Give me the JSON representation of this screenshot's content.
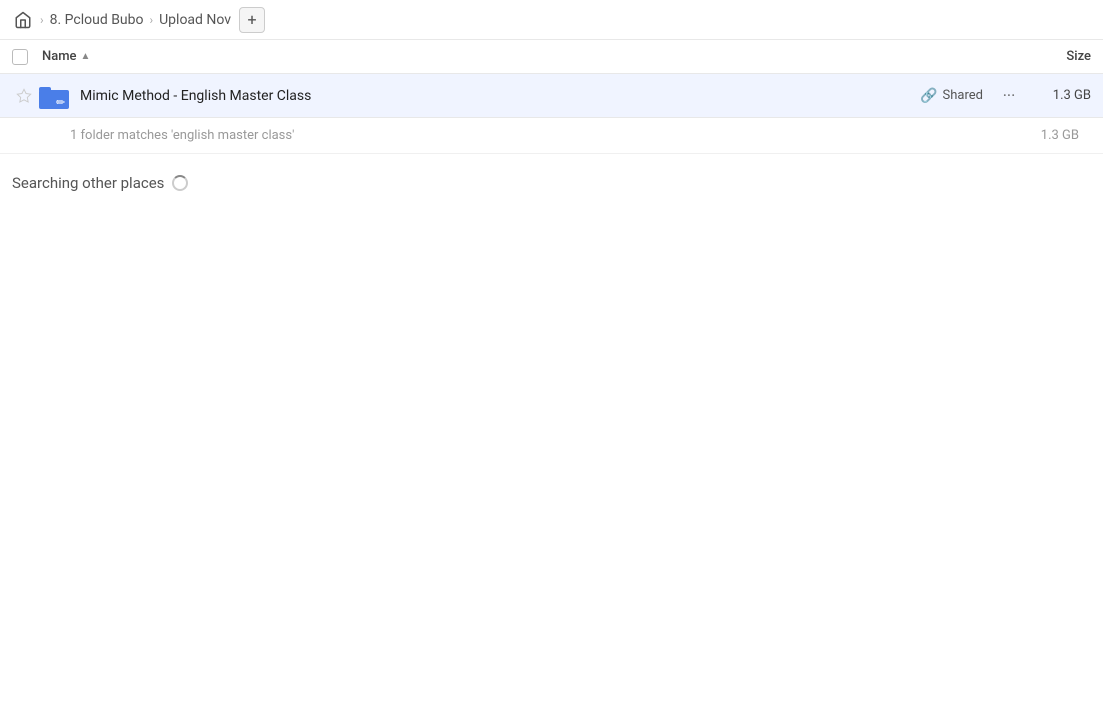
{
  "breadcrumb": {
    "home_label": "Home",
    "item1_label": "8. Pcloud Bubo",
    "item2_label": "Upload Nov",
    "add_button_label": "+"
  },
  "columns": {
    "name_label": "Name",
    "size_label": "Size"
  },
  "file_row": {
    "filename": "Mimic Method - English Master Class",
    "shared_label": "Shared",
    "size": "1.3 GB"
  },
  "match_info": {
    "text": "1 folder matches 'english master class'",
    "size": "1.3 GB"
  },
  "searching": {
    "label": "Searching other places"
  }
}
